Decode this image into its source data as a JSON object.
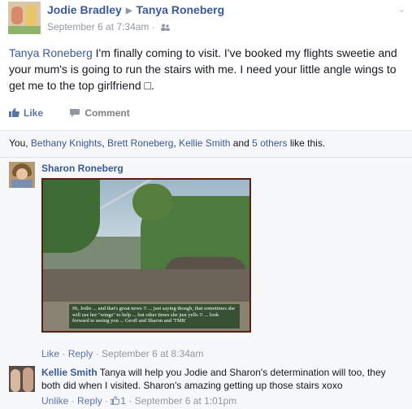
{
  "post": {
    "author": "Jodie Bradley",
    "recipient": "Tanya Roneberg",
    "timestamp": "September 6 at 7:34am",
    "separator": "·",
    "tagged_name": "Tanya Roneberg",
    "body": " I'm finally coming to visit. I've booked my flights sweetie and your mum's is going to run the stairs with me. I need your little angle wings to get me to the top girlfriend □.",
    "like_label": "Like",
    "comment_label": "Comment"
  },
  "likes": {
    "you": "You, ",
    "person1": "Bethany Knights",
    "sep1": ", ",
    "person2": "Brett Roneberg",
    "sep2": ", ",
    "person3": "Kellie Smith",
    "and": " and ",
    "others": "5 others",
    "suffix": " like this."
  },
  "comments": [
    {
      "author": "Sharon Roneberg",
      "photo_caption": "Hi, Jodie ... and that's great news !! ... just saying though, that sometimes she will use her \"wings\" to help ... but other times she just yells !! ... look forward to seeing you ... Geoff and Sharon and 'TMR'",
      "like_label": "Like",
      "dot1": " · ",
      "reply_label": "Reply",
      "dot2": " · ",
      "timestamp": "September 6 at 8:34am"
    },
    {
      "author": "Kellie Smith",
      "text": " Tanya will help you Jodie and Sharon's determination will too, they both did when I visited. Sharon's amazing getting up those stairs xoxo",
      "like_label": "Unlike",
      "dot1": " · ",
      "reply_label": "Reply",
      "dot2": " · ",
      "like_count": "1",
      "dot3": " · ",
      "timestamp": "September 6 at 1:01pm"
    }
  ],
  "colors": {
    "link": "#3b5998",
    "meta": "#9197a3",
    "background": "#f6f7f9"
  },
  "icons": [
    "friends-icon",
    "chevron-down-icon",
    "thumbs-up-icon",
    "comment-icon"
  ]
}
